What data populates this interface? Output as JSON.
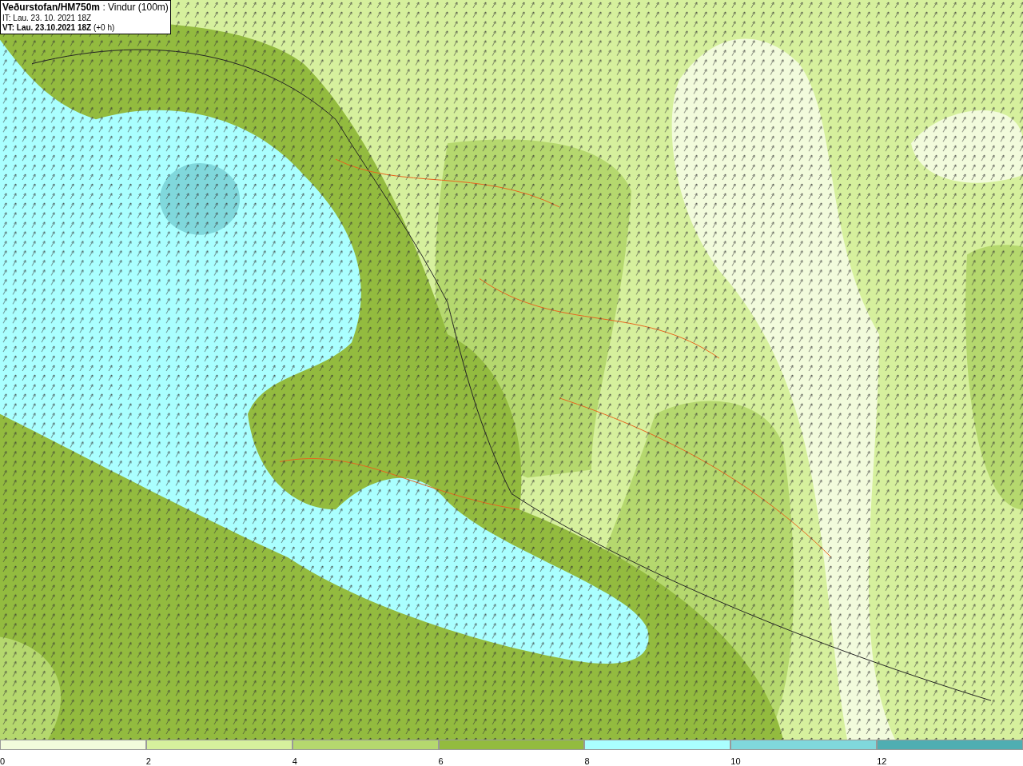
{
  "map_header": {
    "lines": [
      "**Veðurstofan/HM750m** : Vindur (100m)",
      "IT: Lau. 23. 10. 2021 18Z",
      "**VT: Lau. 23.10.2021 18Z** (+0 h)"
    ]
  },
  "legend": {
    "bins": [
      {
        "label": "0",
        "color": "#f2fbdc"
      },
      {
        "label": "2",
        "color": "#d6f09d"
      },
      {
        "label": "4",
        "color": "#b5d86e"
      },
      {
        "label": "6",
        "color": "#93bb3f"
      },
      {
        "label": "8",
        "color": "#aaffff"
      },
      {
        "label": "10",
        "color": "#80d8dc"
      },
      {
        "label": "12",
        "color": "#4faeb2"
      }
    ]
  }
}
